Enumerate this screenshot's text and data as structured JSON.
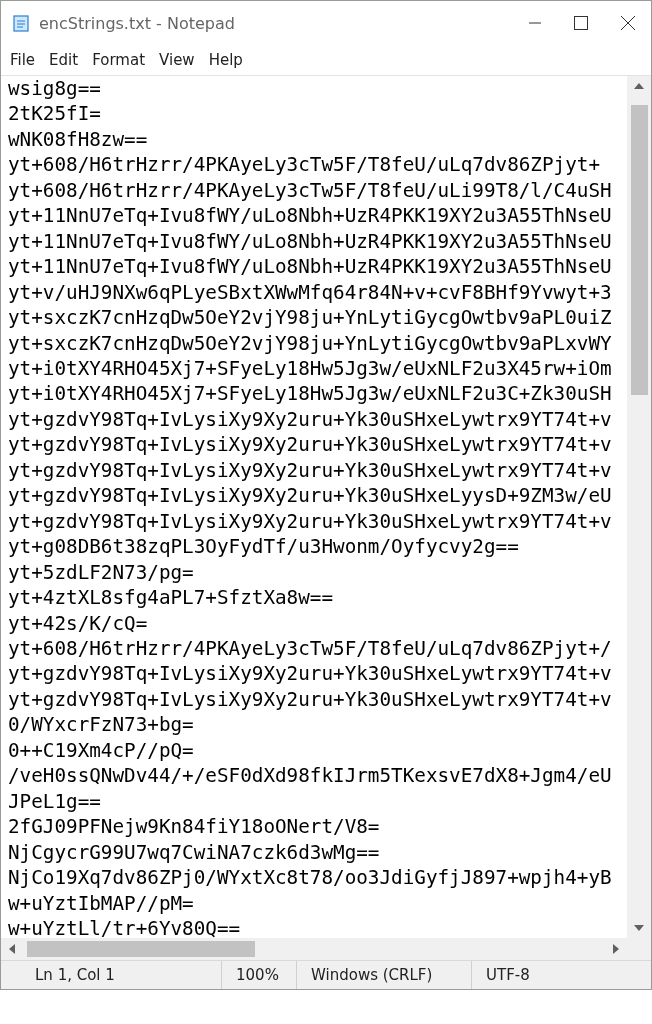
{
  "window": {
    "title": "encStrings.txt - Notepad"
  },
  "menu": [
    "File",
    "Edit",
    "Format",
    "View",
    "Help"
  ],
  "lines": [
    "wsig8g==",
    "2tK25fI=",
    "wNK08fH8zw==",
    "yt+608/H6trHzrr/4PKAyeLy3cTw5F/T8feU/uLq7dv86ZPjyt+",
    "yt+608/H6trHzrr/4PKAyeLy3cTw5F/T8feU/uLi99T8/l/C4uSH",
    "yt+11NnU7eTq+Ivu8fWY/uLo8Nbh+UzR4PKK19XY2u3A55ThNseU",
    "yt+11NnU7eTq+Ivu8fWY/uLo8Nbh+UzR4PKK19XY2u3A55ThNseU",
    "yt+11NnU7eTq+Ivu8fWY/uLo8Nbh+UzR4PKK19XY2u3A55ThNseU",
    "yt+v/uHJ9NXw6qPLyeSBxtXWwMfq64r84N+v+cvF8BHf9Yvwyt+3",
    "yt+sxczK7cnHzqDw5OeY2vjY98ju+YnLytiGycgOwtbv9aPL0uiZ",
    "yt+sxczK7cnHzqDw5OeY2vjY98ju+YnLytiGycgOwtbv9aPLxvWY",
    "yt+i0tXY4RHO45Xj7+SFyeLy18Hw5Jg3w/eUxNLF2u3X45rw+iOm",
    "yt+i0tXY4RHO45Xj7+SFyeLy18Hw5Jg3w/eUxNLF2u3C+Zk30uSH",
    "yt+gzdvY98Tq+IvLysiXy9Xy2uru+Yk30uSHxeLywtrx9YT74t+v",
    "yt+gzdvY98Tq+IvLysiXy9Xy2uru+Yk30uSHxeLywtrx9YT74t+v",
    "yt+gzdvY98Tq+IvLysiXy9Xy2uru+Yk30uSHxeLywtrx9YT74t+v",
    "yt+gzdvY98Tq+IvLysiXy9Xy2uru+Yk30uSHxeLyysD+9ZM3w/eU",
    "yt+gzdvY98Tq+IvLysiXy9Xy2uru+Yk30uSHxeLywtrx9YT74t+v",
    "yt+g08DB6t38zqPL3OyFydTf/u3Hwonm/Oyfycvy2g==",
    "yt+5zdLF2N73/pg=",
    "yt+4ztXL8sfg4aPL7+SfztXa8w==",
    "yt+42s/K/cQ=",
    "yt+608/H6trHzrr/4PKAyeLy3cTw5F/T8feU/uLq7dv86ZPjyt+/",
    "yt+gzdvY98Tq+IvLysiXy9Xy2uru+Yk30uSHxeLywtrx9YT74t+v",
    "yt+gzdvY98Tq+IvLysiXy9Xy2uru+Yk30uSHxeLywtrx9YT74t+v",
    "0/WYxcrFzN73+bg=",
    "0++C19Xm4cP//pQ=",
    "/veH0ssQNwDv44/+/eSF0dXd98fkIJrm5TKexsvE7dX8+Jgm4/eU",
    "JPeL1g==",
    "2fGJ09PFNejw9Kn84fiY18oONert/V8=",
    "NjCgycrG99U7wq7CwiNA7czk6d3wMg==",
    "NjCo19Xq7dv86ZPj0/WYxtXc8t78/oo3JdiGyfjJ897+wpjh4+yB",
    "w+uYztIbMAP//pM=",
    "w+uYztLl/tr+6Yv80Q=="
  ],
  "status_bar": [
    "Ln 1, Col 1",
    "100%",
    "Windows (CRLF)",
    "UTF-8"
  ]
}
